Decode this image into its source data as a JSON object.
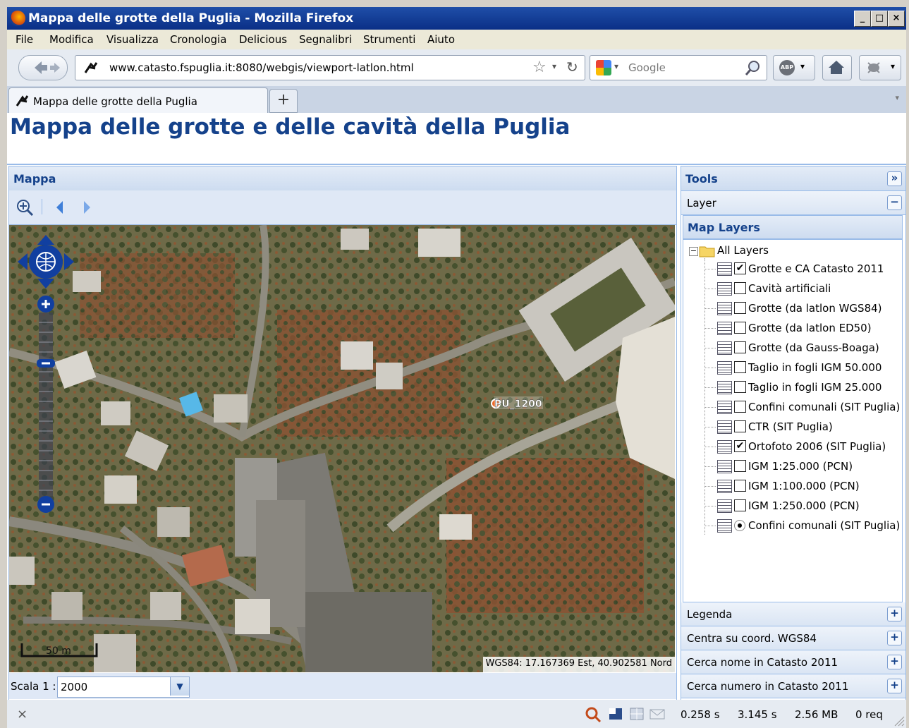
{
  "window": {
    "title": "Mappa delle grotte della Puglia - Mozilla Firefox",
    "min": "_",
    "max": "□",
    "close": "×"
  },
  "menu": [
    "File",
    "Modifica",
    "Visualizza",
    "Cronologia",
    "Delicious",
    "Segnalibri",
    "Strumenti",
    "Aiuto"
  ],
  "nav": {
    "url": "www.catasto.fspuglia.it:8080/webgis/viewport-latlon.html",
    "search_placeholder": "Google",
    "abp": "ABP"
  },
  "tab": {
    "label": "Mappa delle grotte della Puglia",
    "new_tab": "+"
  },
  "page": {
    "title": "Mappa delle grotte e delle cavità della Puglia"
  },
  "map_panel": {
    "header": "Mappa",
    "marker_label": "PU_1200",
    "scale_bar_label": "50 m",
    "coords": "WGS84: 17.167369 Est, 40.902581 Nord",
    "scale_label": "Scala 1 :",
    "scale_value": "2000"
  },
  "tools_panel": {
    "header": "Tools",
    "layer_section": "Layer",
    "map_layers_header": "Map Layers",
    "root": "All Layers",
    "layers": [
      {
        "name": "Grotte e CA Catasto 2011",
        "checked": true,
        "type": "check"
      },
      {
        "name": "Cavità artificiali",
        "checked": false,
        "type": "check"
      },
      {
        "name": "Grotte (da latlon WGS84)",
        "checked": false,
        "type": "check"
      },
      {
        "name": "Grotte (da latlon ED50)",
        "checked": false,
        "type": "check"
      },
      {
        "name": "Grotte (da Gauss-Boaga)",
        "checked": false,
        "type": "check"
      },
      {
        "name": "Taglio in fogli IGM 50.000",
        "checked": false,
        "type": "check"
      },
      {
        "name": "Taglio in fogli IGM 25.000",
        "checked": false,
        "type": "check"
      },
      {
        "name": "Confini comunali (SIT Puglia)",
        "checked": false,
        "type": "check"
      },
      {
        "name": "CTR (SIT Puglia)",
        "checked": false,
        "type": "check"
      },
      {
        "name": "Ortofoto 2006 (SIT Puglia)",
        "checked": true,
        "type": "check"
      },
      {
        "name": "IGM 1:25.000 (PCN)",
        "checked": false,
        "type": "check"
      },
      {
        "name": "IGM 1:100.000 (PCN)",
        "checked": false,
        "type": "check"
      },
      {
        "name": "IGM 1:250.000 (PCN)",
        "checked": false,
        "type": "check"
      },
      {
        "name": "Confini comunali (SIT Puglia)",
        "checked": true,
        "type": "radio"
      }
    ],
    "accordion": [
      "Legenda",
      "Centra su coord. WGS84",
      "Cerca nome in Catasto 2011",
      "Cerca numero in Catasto 2011"
    ]
  },
  "status": {
    "close": "×",
    "t1": "0.258 s",
    "t2": "3.145 s",
    "size": "2.56 MB",
    "req": "0 req"
  }
}
